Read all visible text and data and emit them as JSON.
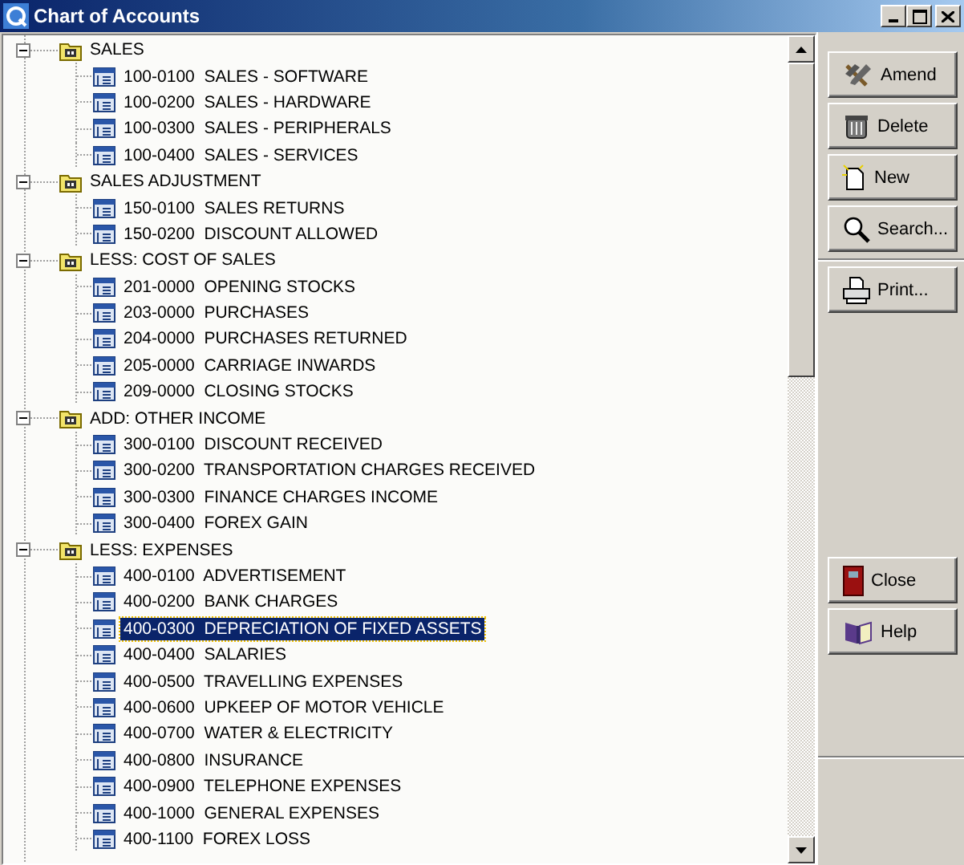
{
  "window": {
    "title": "Chart of Accounts"
  },
  "tree": [
    {
      "label": "SALES",
      "expanded": true,
      "children": [
        {
          "label": "100-0100  SALES - SOFTWARE",
          "selected": false
        },
        {
          "label": "100-0200  SALES - HARDWARE",
          "selected": false
        },
        {
          "label": "100-0300  SALES - PERIPHERALS",
          "selected": false
        },
        {
          "label": "100-0400  SALES - SERVICES",
          "selected": false
        }
      ]
    },
    {
      "label": "SALES ADJUSTMENT",
      "expanded": true,
      "children": [
        {
          "label": "150-0100  SALES RETURNS",
          "selected": false
        },
        {
          "label": "150-0200  DISCOUNT ALLOWED",
          "selected": false
        }
      ]
    },
    {
      "label": "LESS: COST OF SALES",
      "expanded": true,
      "children": [
        {
          "label": "201-0000  OPENING STOCKS",
          "selected": false
        },
        {
          "label": "203-0000  PURCHASES",
          "selected": false
        },
        {
          "label": "204-0000  PURCHASES RETURNED",
          "selected": false
        },
        {
          "label": "205-0000  CARRIAGE INWARDS",
          "selected": false
        },
        {
          "label": "209-0000  CLOSING STOCKS",
          "selected": false
        }
      ]
    },
    {
      "label": "ADD: OTHER INCOME",
      "expanded": true,
      "children": [
        {
          "label": "300-0100  DISCOUNT RECEIVED",
          "selected": false
        },
        {
          "label": "300-0200  TRANSPORTATION CHARGES RECEIVED",
          "selected": false
        },
        {
          "label": "300-0300  FINANCE CHARGES INCOME",
          "selected": false
        },
        {
          "label": "300-0400  FOREX GAIN",
          "selected": false
        }
      ]
    },
    {
      "label": "LESS: EXPENSES",
      "expanded": true,
      "children": [
        {
          "label": "400-0100  ADVERTISEMENT",
          "selected": false
        },
        {
          "label": "400-0200  BANK CHARGES",
          "selected": false
        },
        {
          "label": "400-0300  DEPRECIATION OF FIXED ASSETS",
          "selected": true
        },
        {
          "label": "400-0400  SALARIES",
          "selected": false
        },
        {
          "label": "400-0500  TRAVELLING EXPENSES",
          "selected": false
        },
        {
          "label": "400-0600  UPKEEP OF MOTOR VEHICLE",
          "selected": false
        },
        {
          "label": "400-0700  WATER & ELECTRICITY",
          "selected": false
        },
        {
          "label": "400-0800  INSURANCE",
          "selected": false
        },
        {
          "label": "400-0900  TELEPHONE EXPENSES",
          "selected": false
        },
        {
          "label": "400-1000  GENERAL EXPENSES",
          "selected": false
        },
        {
          "label": "400-1100  FOREX LOSS",
          "selected": false
        }
      ]
    }
  ],
  "button_groups": [
    {
      "buttons": [
        {
          "label": "Amend",
          "kind": "tools"
        },
        {
          "label": "Delete",
          "kind": "bin"
        },
        {
          "label": "New",
          "kind": "document"
        },
        {
          "label": "Search...",
          "kind": "magnifier"
        }
      ]
    },
    {
      "buttons": [
        {
          "label": "Print...",
          "kind": "printer"
        }
      ]
    },
    {
      "buttons": [
        {
          "label": "Close",
          "kind": "door"
        },
        {
          "label": "Help",
          "kind": "book"
        }
      ]
    }
  ]
}
